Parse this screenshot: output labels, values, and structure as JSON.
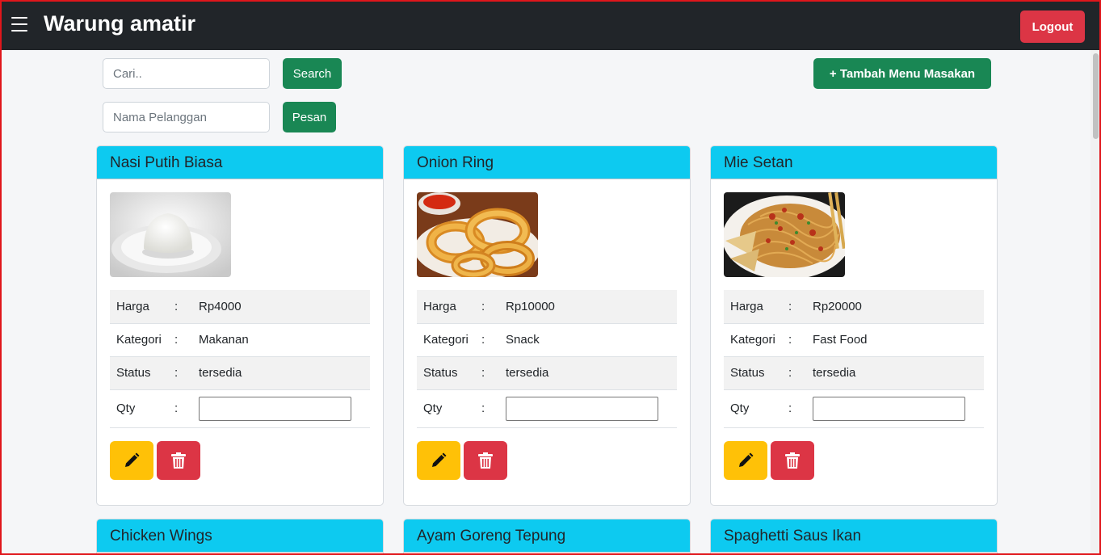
{
  "app": {
    "title": "Warung amatir",
    "logout_label": "Logout"
  },
  "toolbar": {
    "search_placeholder": "Cari..",
    "search_label": "Search",
    "customer_placeholder": "Nama Pelanggan",
    "order_label": "Pesan",
    "add_menu_label": "+ Tambah Menu Masakan"
  },
  "labels": {
    "price": "Harga",
    "category": "Kategori",
    "status": "Status",
    "qty": "Qty",
    "colon": ":"
  },
  "menu": [
    {
      "name": "Nasi Putih Biasa",
      "price": "Rp4000",
      "category": "Makanan",
      "status": "tersedia",
      "image": "rice-plate"
    },
    {
      "name": "Onion Ring",
      "price": "Rp10000",
      "category": "Snack",
      "status": "tersedia",
      "image": "onion-rings"
    },
    {
      "name": "Mie Setan",
      "price": "Rp20000",
      "category": "Fast Food",
      "status": "tersedia",
      "image": "spicy-noodles"
    },
    {
      "name": "Chicken Wings"
    },
    {
      "name": "Ayam Goreng Tepung"
    },
    {
      "name": "Spaghetti Saus Ikan"
    }
  ],
  "colors": {
    "navbar": "#212529",
    "card_header": "#0dcaf0",
    "success": "#198754",
    "danger": "#dc3545",
    "warning": "#ffc107"
  }
}
